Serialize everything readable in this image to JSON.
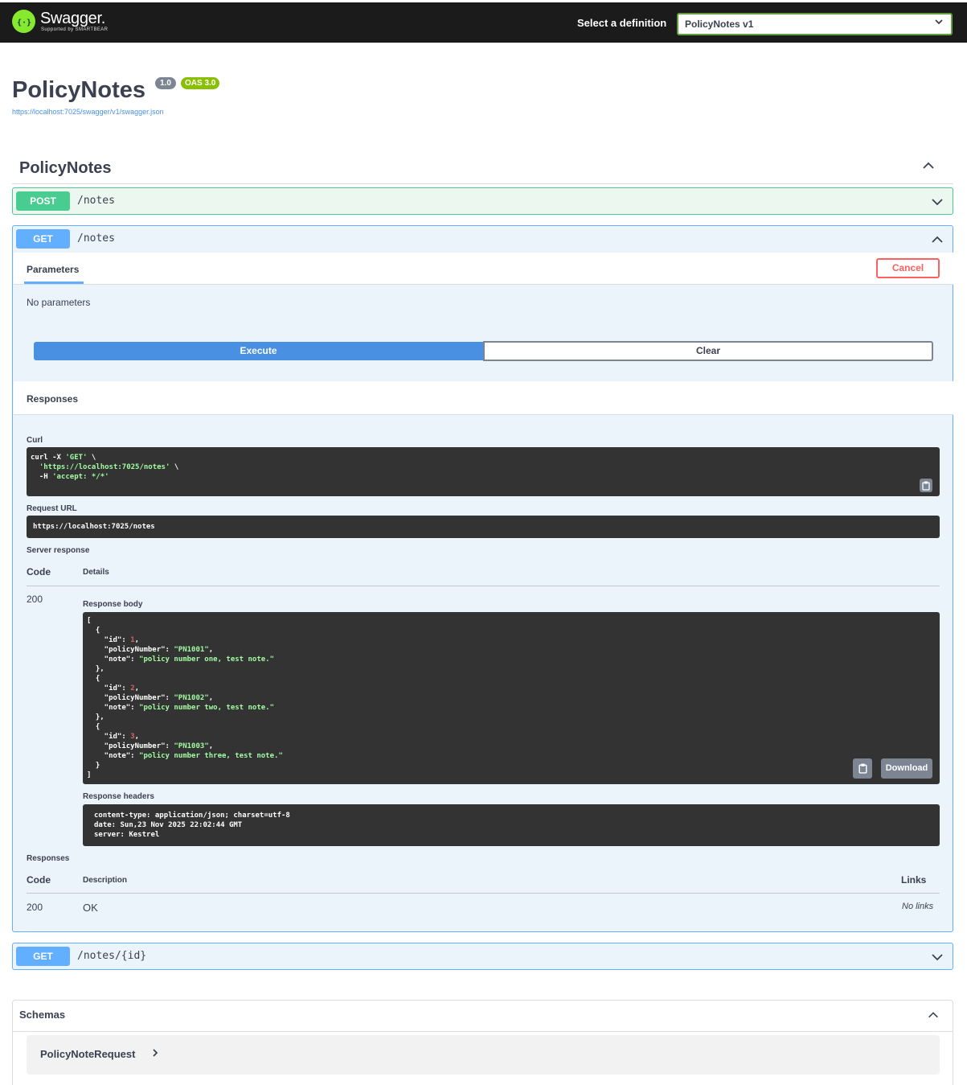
{
  "topbar": {
    "logo_glyph": "{···}",
    "logo_name": "Swagger.",
    "logo_sub": "Supported by SMARTBEAR",
    "definition_label": "Select a definition",
    "definition_value": "PolicyNotes v1"
  },
  "info": {
    "title": "PolicyNotes",
    "version": "1.0",
    "oas": "OAS 3.0",
    "url": "https://localhost:7025/swagger/v1/swagger.json"
  },
  "tag": {
    "name": "PolicyNotes"
  },
  "operations": [
    {
      "method": "POST",
      "path": "/notes"
    },
    {
      "method": "GET",
      "path": "/notes"
    },
    {
      "method": "GET",
      "path": "/notes/{id}"
    }
  ],
  "get_notes": {
    "parameters_tab": "Parameters",
    "cancel_label": "Cancel",
    "no_params": "No parameters",
    "execute_label": "Execute",
    "clear_label": "Clear",
    "responses_title": "Responses",
    "curl_label": "Curl",
    "curl_lines": [
      "curl -X ",
      "'GET'",
      " \\",
      "'https://localhost:7025/notes'",
      " \\",
      "-H ",
      "'accept: */*'"
    ],
    "request_url_label": "Request URL",
    "request_url": "https://localhost:7025/notes",
    "server_response_label": "Server response",
    "code_header": "Code",
    "details_header": "Details",
    "response_code": "200",
    "response_body_label": "Response body",
    "response_body": [
      {
        "id": 1,
        "policyNumber": "PN1001",
        "note": "policy number one, test note."
      },
      {
        "id": 2,
        "policyNumber": "PN1002",
        "note": "policy number two, test note."
      },
      {
        "id": 3,
        "policyNumber": "PN1003",
        "note": "policy number three, test note."
      }
    ],
    "download_label": "Download",
    "response_headers_label": "Response headers",
    "response_headers": [
      "content-type: application/json; charset=utf-8",
      "date: Sun,23 Nov 2025 22:02:44 GMT",
      "server: Kestrel"
    ],
    "responses_label": "Responses",
    "description_header": "Description",
    "links_header": "Links",
    "resp_code": "200",
    "resp_description": "OK",
    "resp_links": "No links"
  },
  "schemas": {
    "title": "Schemas",
    "models": [
      "PolicyNoteRequest"
    ]
  },
  "colors": {
    "post": "#49cc90",
    "get": "#61affe",
    "execute": "#4990e2",
    "cancel": "#ff6060",
    "topbar": "#1b1b1b",
    "brand": "#85ea2d"
  }
}
